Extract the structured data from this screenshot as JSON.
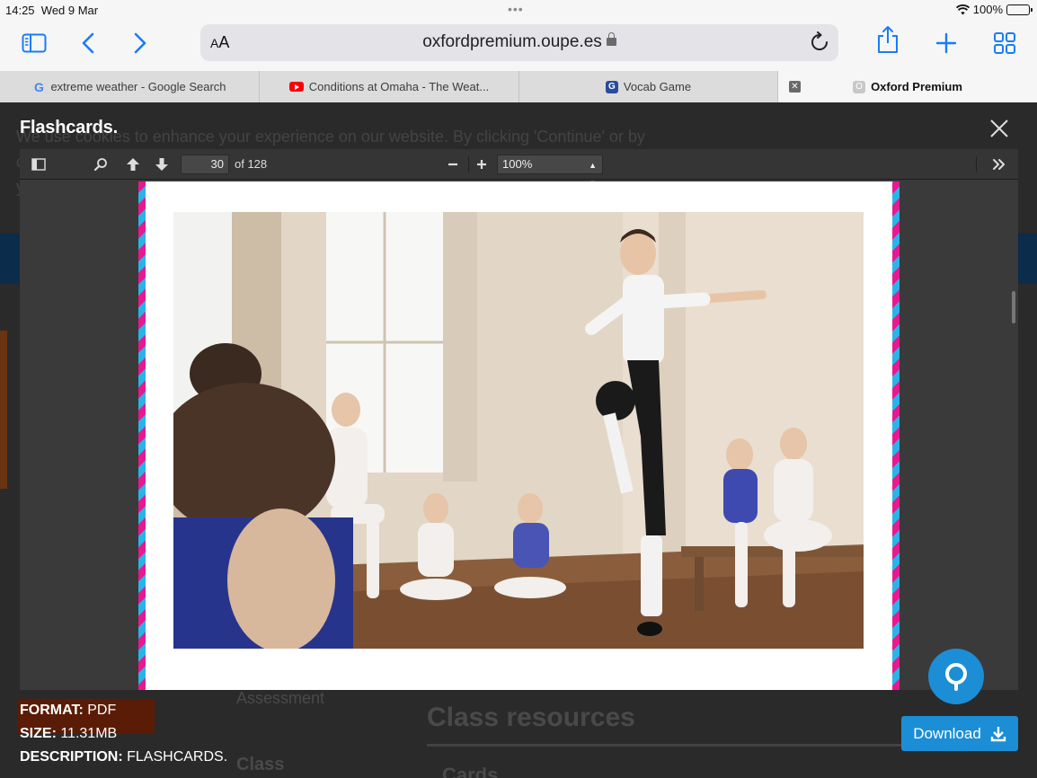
{
  "status": {
    "time": "14:25",
    "date": "Wed 9 Mar",
    "battery": "100%"
  },
  "toolbar": {
    "aa": "AA",
    "url": "oxfordpremium.oupe.es"
  },
  "tabs": [
    {
      "label": "extreme weather - Google Search",
      "icon": "google-icon"
    },
    {
      "label": "Conditions at Omaha - The Weat...",
      "icon": "youtube-icon"
    },
    {
      "label": "Vocab Game",
      "icon": "vocab-game-icon"
    },
    {
      "label": "Oxford Premium",
      "icon": "oxford-icon",
      "active": true
    }
  ],
  "background": {
    "cookie_line1": "We use cookies to enhance your experience on our website. By clicking 'Continue' or by",
    "cookie_line2": "c",
    "cookie_line3": "y",
    "menu_item": "Assessment",
    "class_resources": "Class resources",
    "class_label": "Class",
    "cards_label": "Cards"
  },
  "modal": {
    "title": "Flashcards."
  },
  "pdf": {
    "page": "30",
    "of_label": "of 128",
    "zoom": "100%"
  },
  "file": {
    "format_label": "FORMAT:",
    "format_value": "PDF",
    "size_label": "SIZE:",
    "size_value": "11.31MB",
    "description_label": "DESCRIPTION:",
    "description_value": "FLASHCARDS.",
    "download_label": "Download"
  },
  "colors": {
    "accent": "#1b8ed6",
    "safari_blue": "#1a7cf5",
    "stripe_pink": "#e7198e",
    "stripe_blue": "#2ab3e8"
  }
}
